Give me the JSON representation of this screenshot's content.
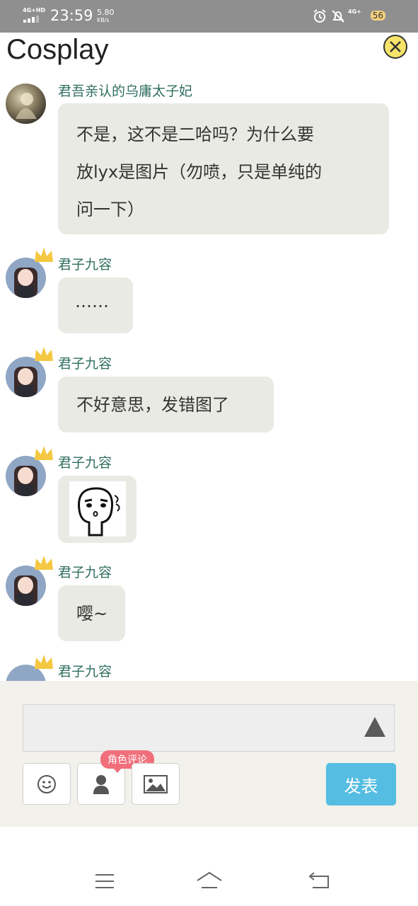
{
  "status_bar": {
    "network": "4G+HD",
    "time": "23:59",
    "speed_value": "5.80",
    "speed_unit": "KB/s",
    "network_right": "4G+",
    "battery": "56"
  },
  "header": {
    "title": "Cosplay"
  },
  "messages": [
    {
      "user": "君吾亲认的乌庸太子妃",
      "lines": [
        "不是，这不是二哈吗？为什么要",
        "放lyx是图片（勿喷，只是单纯的",
        "问一下）"
      ]
    },
    {
      "user": "君子九容",
      "text": "……"
    },
    {
      "user": "君子九容",
      "text": "不好意思，发错图了"
    },
    {
      "user": "君子九容",
      "type": "image",
      "image_desc": "sticker-face"
    },
    {
      "user": "君子九容",
      "text": "嘤~"
    },
    {
      "user": "君子九容"
    }
  ],
  "composer": {
    "input_value": "",
    "role_comment_badge": "角色评论",
    "submit_label": "发表"
  },
  "colors": {
    "submit": "#56bde2",
    "badge": "#f06f7b",
    "bubble": "#e9eae4",
    "username": "#2f6e5f"
  }
}
